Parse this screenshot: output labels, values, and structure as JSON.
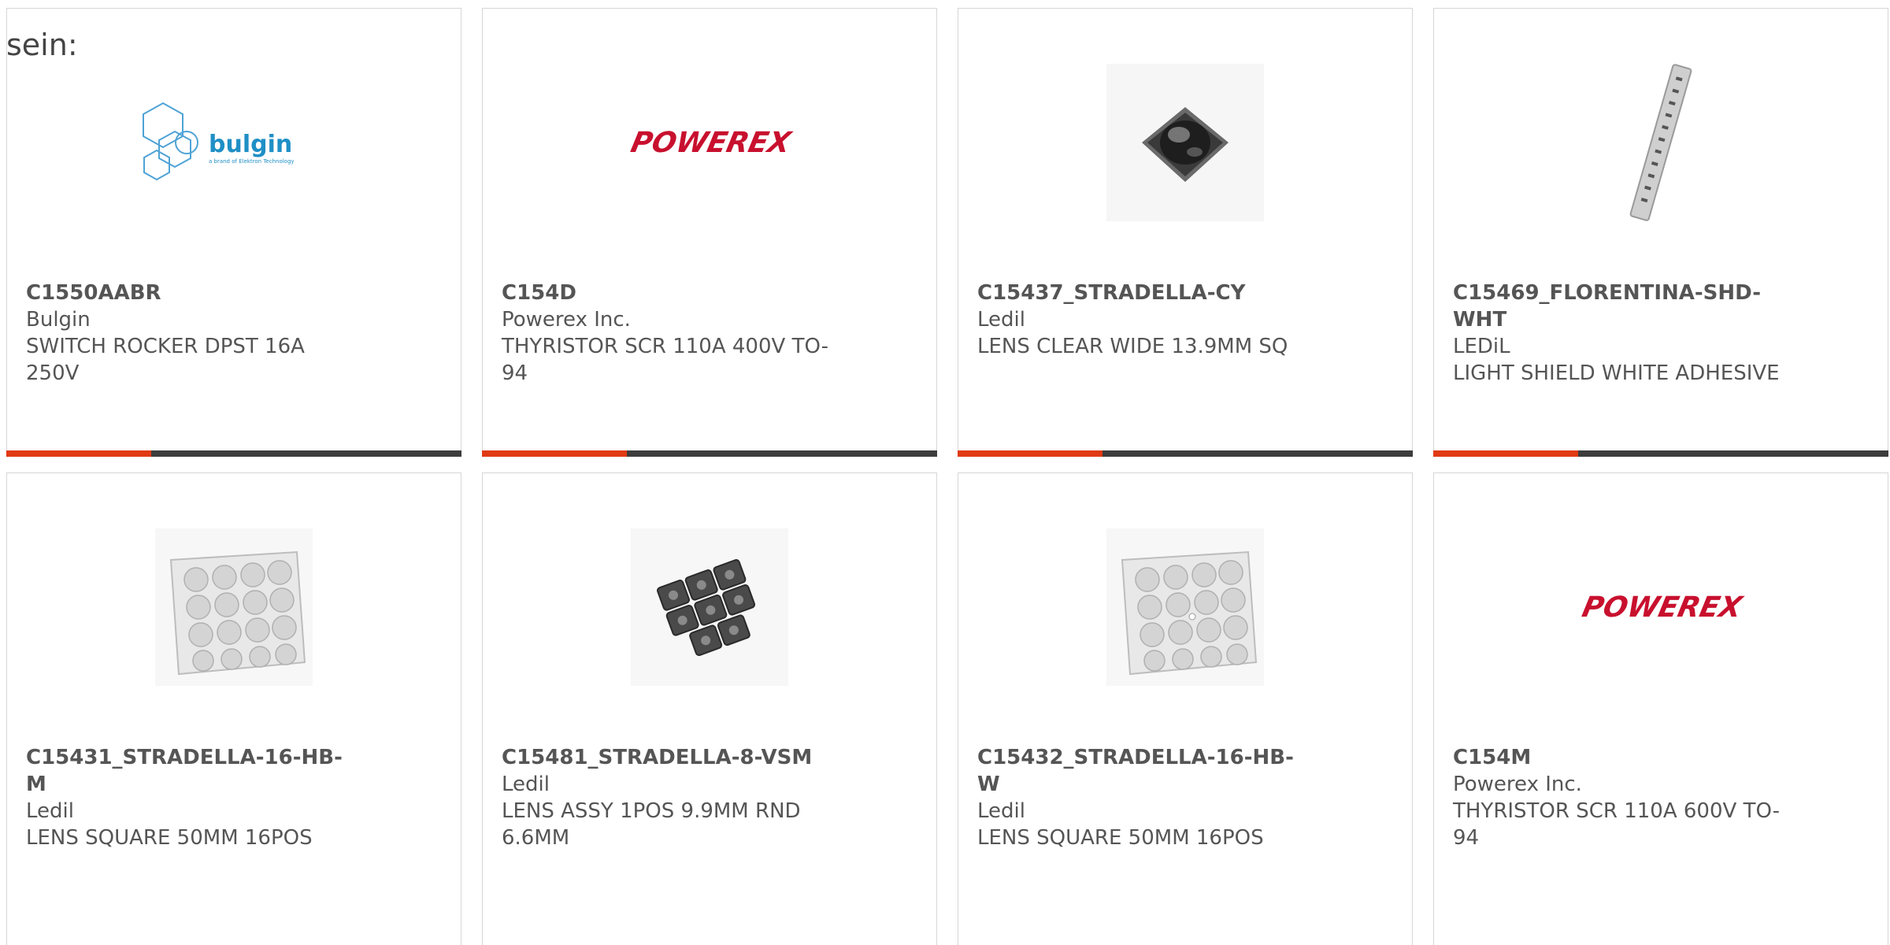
{
  "header_fragment": "sein:",
  "cards": [
    {
      "part": "C1550AABR",
      "maker": "Bulgin",
      "desc": "SWITCH ROCKER DPST 16A 250V",
      "image": "bulgin-logo",
      "logo_text": "bulgin",
      "logo_sub": "a brand of Elektron Technology"
    },
    {
      "part": "C154D",
      "maker": "Powerex Inc.",
      "desc": "THYRISTOR SCR 110A 400V TO-94",
      "image": "powerex-logo",
      "logo_text": "POWEREX"
    },
    {
      "part": "C15437_STRADELLA-CY",
      "maker": "Ledil",
      "desc": "LENS CLEAR WIDE 13.9MM SQ",
      "image": "lens-photo"
    },
    {
      "part": "C15469_FLORENTINA-SHD-WHT",
      "maker": "LEDiL",
      "desc": "LIGHT SHIELD WHITE ADHESIVE",
      "image": "light-shield-photo"
    },
    {
      "part": "C15431_STRADELLA-16-HB-M",
      "maker": "Ledil",
      "desc": "LENS SQUARE 50MM 16POS",
      "image": "lens-array-photo"
    },
    {
      "part": "C15481_STRADELLA-8-VSM",
      "maker": "Ledil",
      "desc": "LENS ASSY 1POS 9.9MM RND 6.6MM",
      "image": "lens-assy-photo"
    },
    {
      "part": "C15432_STRADELLA-16-HB-W",
      "maker": "Ledil",
      "desc": "LENS SQUARE 50MM 16POS",
      "image": "lens-array-photo"
    },
    {
      "part": "C154M",
      "maker": "Powerex Inc.",
      "desc": "THYRISTOR SCR 110A 600V TO-94",
      "image": "powerex-logo",
      "logo_text": "POWEREX"
    }
  ],
  "colors": {
    "accent": "#e03a15",
    "bar": "#3d3d3d",
    "powerex": "#c8102e",
    "bulgin": "#1f8fc6"
  }
}
